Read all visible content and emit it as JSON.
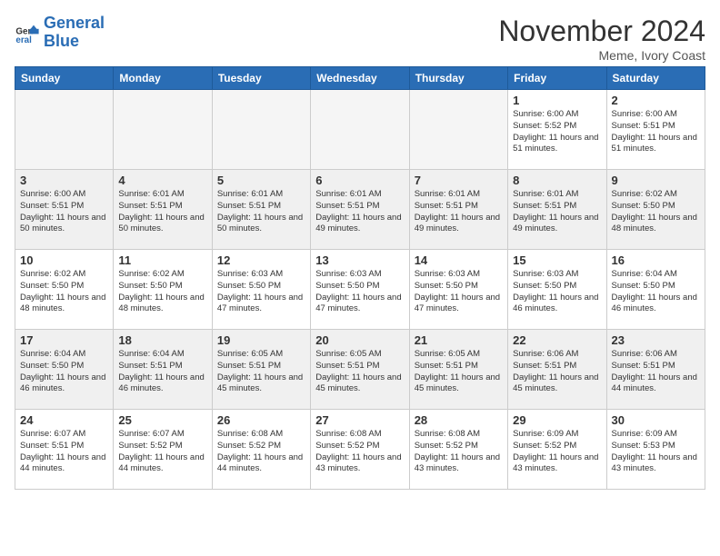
{
  "logo": {
    "line1": "General",
    "line2": "Blue"
  },
  "title": "November 2024",
  "location": "Meme, Ivory Coast",
  "days_header": [
    "Sunday",
    "Monday",
    "Tuesday",
    "Wednesday",
    "Thursday",
    "Friday",
    "Saturday"
  ],
  "weeks": [
    [
      {
        "day": "",
        "empty": true
      },
      {
        "day": "",
        "empty": true
      },
      {
        "day": "",
        "empty": true
      },
      {
        "day": "",
        "empty": true
      },
      {
        "day": "",
        "empty": true
      },
      {
        "day": "1",
        "sunrise": "6:00 AM",
        "sunset": "5:52 PM",
        "daylight": "11 hours and 51 minutes."
      },
      {
        "day": "2",
        "sunrise": "6:00 AM",
        "sunset": "5:51 PM",
        "daylight": "11 hours and 51 minutes."
      }
    ],
    [
      {
        "day": "3",
        "sunrise": "6:00 AM",
        "sunset": "5:51 PM",
        "daylight": "11 hours and 50 minutes."
      },
      {
        "day": "4",
        "sunrise": "6:01 AM",
        "sunset": "5:51 PM",
        "daylight": "11 hours and 50 minutes."
      },
      {
        "day": "5",
        "sunrise": "6:01 AM",
        "sunset": "5:51 PM",
        "daylight": "11 hours and 50 minutes."
      },
      {
        "day": "6",
        "sunrise": "6:01 AM",
        "sunset": "5:51 PM",
        "daylight": "11 hours and 49 minutes."
      },
      {
        "day": "7",
        "sunrise": "6:01 AM",
        "sunset": "5:51 PM",
        "daylight": "11 hours and 49 minutes."
      },
      {
        "day": "8",
        "sunrise": "6:01 AM",
        "sunset": "5:51 PM",
        "daylight": "11 hours and 49 minutes."
      },
      {
        "day": "9",
        "sunrise": "6:02 AM",
        "sunset": "5:50 PM",
        "daylight": "11 hours and 48 minutes."
      }
    ],
    [
      {
        "day": "10",
        "sunrise": "6:02 AM",
        "sunset": "5:50 PM",
        "daylight": "11 hours and 48 minutes."
      },
      {
        "day": "11",
        "sunrise": "6:02 AM",
        "sunset": "5:50 PM",
        "daylight": "11 hours and 48 minutes."
      },
      {
        "day": "12",
        "sunrise": "6:03 AM",
        "sunset": "5:50 PM",
        "daylight": "11 hours and 47 minutes."
      },
      {
        "day": "13",
        "sunrise": "6:03 AM",
        "sunset": "5:50 PM",
        "daylight": "11 hours and 47 minutes."
      },
      {
        "day": "14",
        "sunrise": "6:03 AM",
        "sunset": "5:50 PM",
        "daylight": "11 hours and 47 minutes."
      },
      {
        "day": "15",
        "sunrise": "6:03 AM",
        "sunset": "5:50 PM",
        "daylight": "11 hours and 46 minutes."
      },
      {
        "day": "16",
        "sunrise": "6:04 AM",
        "sunset": "5:50 PM",
        "daylight": "11 hours and 46 minutes."
      }
    ],
    [
      {
        "day": "17",
        "sunrise": "6:04 AM",
        "sunset": "5:50 PM",
        "daylight": "11 hours and 46 minutes."
      },
      {
        "day": "18",
        "sunrise": "6:04 AM",
        "sunset": "5:51 PM",
        "daylight": "11 hours and 46 minutes."
      },
      {
        "day": "19",
        "sunrise": "6:05 AM",
        "sunset": "5:51 PM",
        "daylight": "11 hours and 45 minutes."
      },
      {
        "day": "20",
        "sunrise": "6:05 AM",
        "sunset": "5:51 PM",
        "daylight": "11 hours and 45 minutes."
      },
      {
        "day": "21",
        "sunrise": "6:05 AM",
        "sunset": "5:51 PM",
        "daylight": "11 hours and 45 minutes."
      },
      {
        "day": "22",
        "sunrise": "6:06 AM",
        "sunset": "5:51 PM",
        "daylight": "11 hours and 45 minutes."
      },
      {
        "day": "23",
        "sunrise": "6:06 AM",
        "sunset": "5:51 PM",
        "daylight": "11 hours and 44 minutes."
      }
    ],
    [
      {
        "day": "24",
        "sunrise": "6:07 AM",
        "sunset": "5:51 PM",
        "daylight": "11 hours and 44 minutes."
      },
      {
        "day": "25",
        "sunrise": "6:07 AM",
        "sunset": "5:52 PM",
        "daylight": "11 hours and 44 minutes."
      },
      {
        "day": "26",
        "sunrise": "6:08 AM",
        "sunset": "5:52 PM",
        "daylight": "11 hours and 44 minutes."
      },
      {
        "day": "27",
        "sunrise": "6:08 AM",
        "sunset": "5:52 PM",
        "daylight": "11 hours and 43 minutes."
      },
      {
        "day": "28",
        "sunrise": "6:08 AM",
        "sunset": "5:52 PM",
        "daylight": "11 hours and 43 minutes."
      },
      {
        "day": "29",
        "sunrise": "6:09 AM",
        "sunset": "5:52 PM",
        "daylight": "11 hours and 43 minutes."
      },
      {
        "day": "30",
        "sunrise": "6:09 AM",
        "sunset": "5:53 PM",
        "daylight": "11 hours and 43 minutes."
      }
    ]
  ]
}
